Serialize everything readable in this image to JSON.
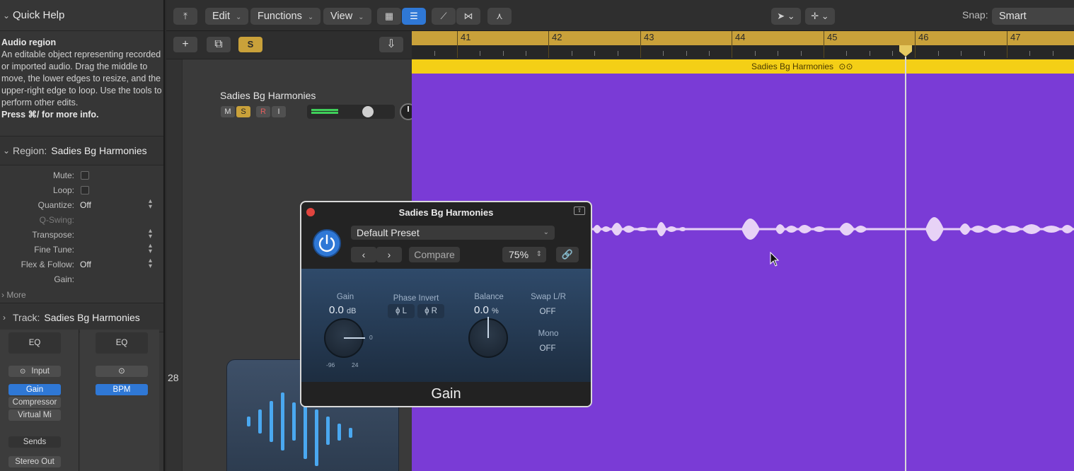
{
  "inspector": {
    "quick_help": {
      "header": "Quick Help",
      "title": "Audio region",
      "description": "An editable object representing recorded or imported audio. Drag the middle to move, the lower edges to resize, and the upper-right edge to loop. Use the tools to perform other edits.",
      "more_info": "Press ⌘/ for more info."
    },
    "region": {
      "label": "Region:",
      "name": "Sadies Bg Harmonies",
      "params": {
        "mute": "Mute:",
        "loop": "Loop:",
        "quantize": "Quantize:",
        "quantize_value": "Off",
        "qswing": "Q-Swing:",
        "transpose": "Transpose:",
        "fine_tune": "Fine Tune:",
        "flex_follow": "Flex & Follow:",
        "flex_follow_value": "Off",
        "gain": "Gain:"
      },
      "more": "More"
    },
    "track": {
      "label": "Track:",
      "name": "Sadies Bg Harmonies"
    },
    "channel_strips": {
      "strip1": {
        "eq": "EQ",
        "input": "Input",
        "plugins": [
          "Gain",
          "Compressor",
          "Virtual Mi"
        ],
        "sends": "Sends",
        "output": "Stereo Out"
      },
      "strip2": {
        "eq": "EQ",
        "plugin": "BPM"
      }
    }
  },
  "toolbar": {
    "edit": "Edit",
    "functions": "Functions",
    "view": "View",
    "snap_label": "Snap:",
    "snap_value": "Smart"
  },
  "tracks": {
    "solo_button": "S",
    "track_name": "Sadies Bg Harmonies",
    "mute": "M",
    "solo": "S",
    "record": "R",
    "input_monitor": "I",
    "track_number": "28"
  },
  "ruler": {
    "bars": [
      "41",
      "42",
      "43",
      "44",
      "45",
      "46",
      "47"
    ]
  },
  "region": {
    "name": "Sadies Bg Harmonies",
    "color": "#7a3bd6"
  },
  "plugin": {
    "title": "Sadies Bg Harmonies",
    "preset": "Default Preset",
    "compare": "Compare",
    "zoom": "75%",
    "gain_label": "Gain",
    "gain_value": "0.0",
    "gain_unit": "dB",
    "gain_scale_min": "-96",
    "gain_scale_max": "24",
    "gain_scale_zero": "0",
    "phase_invert_label": "Phase Invert",
    "phase_l": "L",
    "phase_r": "R",
    "balance_label": "Balance",
    "balance_value": "0.0",
    "balance_unit": "%",
    "swap_label": "Swap L/R",
    "swap_value": "OFF",
    "mono_label": "Mono",
    "mono_value": "OFF",
    "footer": "Gain"
  }
}
